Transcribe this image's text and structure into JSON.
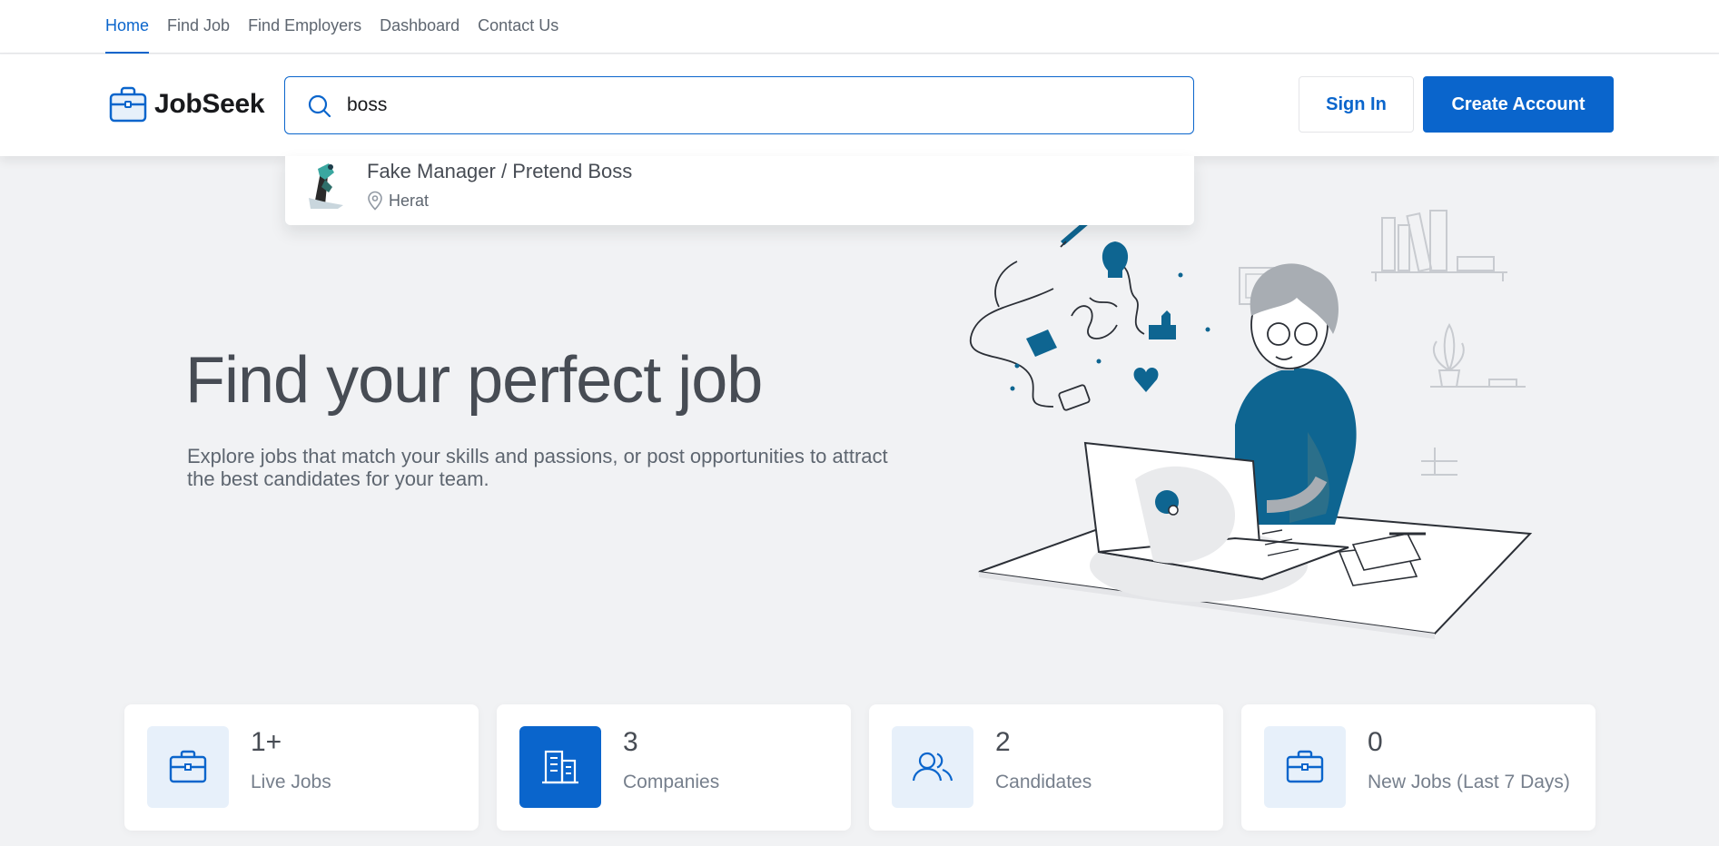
{
  "nav": {
    "items": [
      {
        "label": "Home",
        "active": true
      },
      {
        "label": "Find Job",
        "active": false
      },
      {
        "label": "Find Employers",
        "active": false
      },
      {
        "label": "Dashboard",
        "active": false
      },
      {
        "label": "Contact Us",
        "active": false
      }
    ]
  },
  "header": {
    "logo_text": "JobSeek",
    "search_value": "boss",
    "signin_label": "Sign In",
    "create_label": "Create Account"
  },
  "dropdown": {
    "results": [
      {
        "title": "Fake Manager / Pretend Boss",
        "location": "Herat"
      }
    ]
  },
  "hero": {
    "title": "Find your perfect job",
    "subtitle": "Explore jobs that match your skills and passions, or post opportunities to attract the best candidates for your team."
  },
  "stats": [
    {
      "value": "1+",
      "label": "Live Jobs",
      "icon": "briefcase-icon"
    },
    {
      "value": "3",
      "label": "Companies",
      "icon": "buildings-icon"
    },
    {
      "value": "2",
      "label": "Candidates",
      "icon": "users-icon"
    },
    {
      "value": "0",
      "label": "New Jobs (Last 7 Days)",
      "icon": "briefcase-icon"
    }
  ],
  "colors": {
    "accent": "#0a65cc",
    "background": "#f1f2f4",
    "illustration_blue": "#0e6591"
  }
}
